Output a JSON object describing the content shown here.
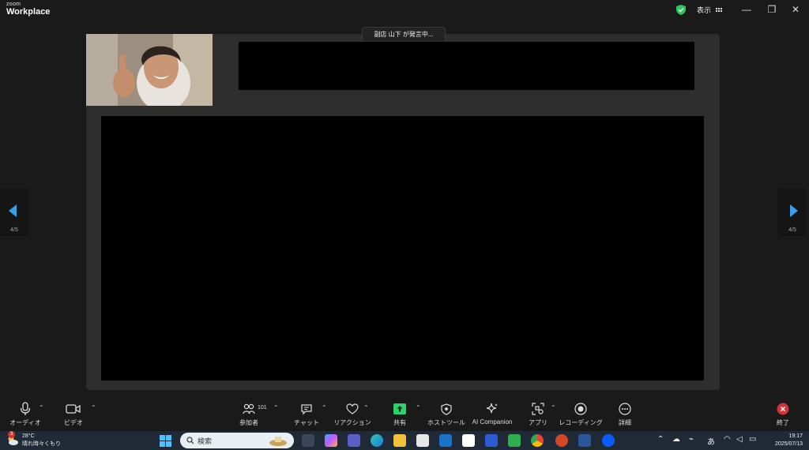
{
  "app": {
    "brand_small": "zoom",
    "brand_name": "Workplace"
  },
  "titlebar": {
    "view_label": "表示",
    "min": "—",
    "restore": "❐",
    "close": "✕"
  },
  "speaker": {
    "text": "副店 山下 が発言中..."
  },
  "pager": {
    "left": "4/5",
    "right": "4/5"
  },
  "toolbar": {
    "audio": "オーディオ",
    "video": "ビデオ",
    "participants": "参加者",
    "participants_count": "101",
    "chat": "チャット",
    "reactions": "リアクション",
    "share": "共有",
    "host_tools": "ホストツール",
    "ai_companion": "AI Companion",
    "apps": "アプリ",
    "recording": "レコーディング",
    "more": "詳細",
    "end": "終了"
  },
  "taskbar": {
    "weather_badge": "3",
    "temp": "28°C",
    "weather_text": "晴れ時々くもり",
    "search_placeholder": "検索",
    "ime": "あ",
    "time": "19:17",
    "date": "2025/07/13"
  },
  "colors": {
    "accent": "#3aa0e8",
    "share_green": "#2ad36b",
    "end_red": "#d13438"
  }
}
